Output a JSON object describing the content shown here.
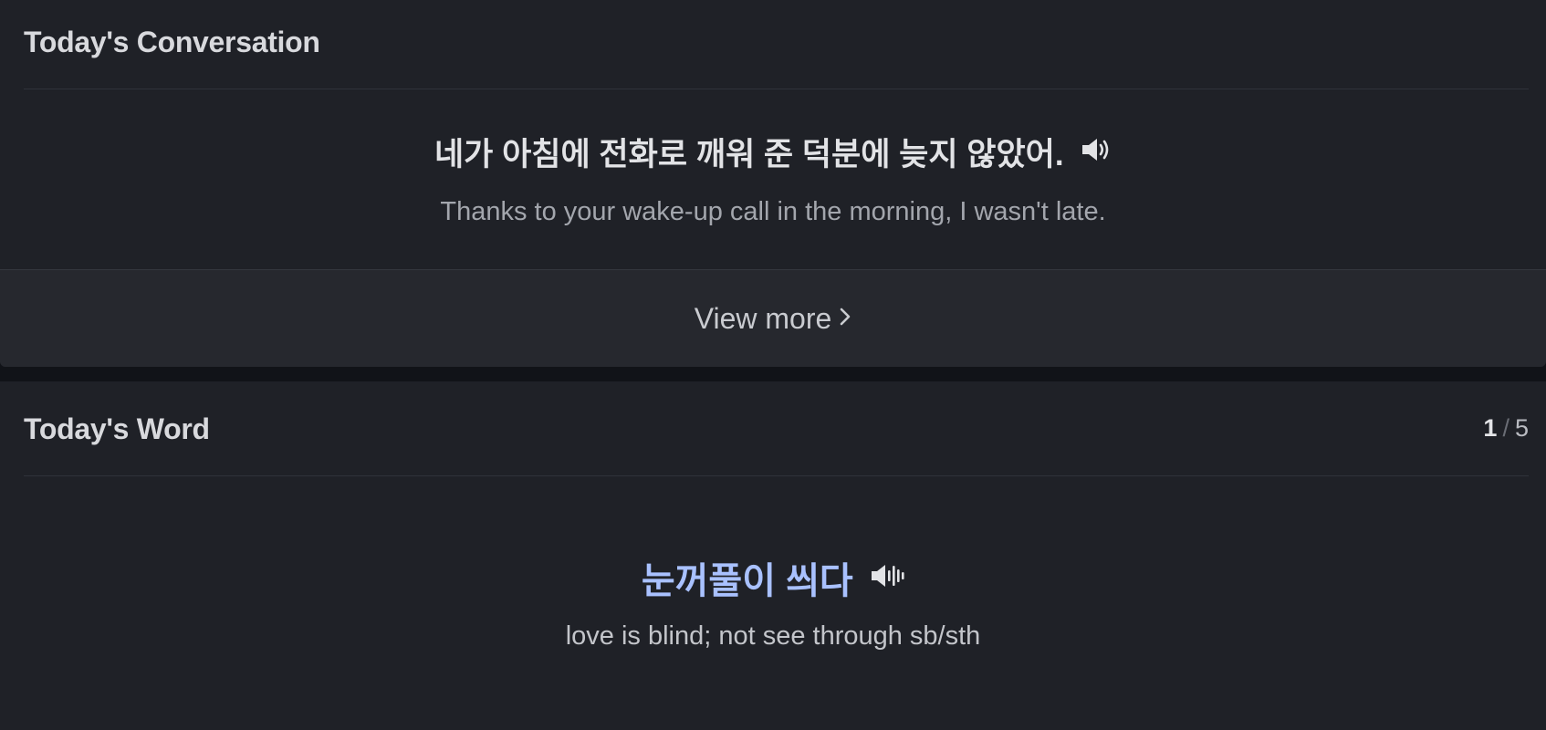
{
  "conversation": {
    "title": "Today's Conversation",
    "sentence_ko": "네가 아침에 전화로 깨워 준 덕분에 늦지 않았어.",
    "sentence_en": "Thanks to your wake-up call in the morning, I wasn't late.",
    "speaker_icon": "speaker-icon",
    "view_more_label": "View more",
    "view_more_icon": "chevron-right-icon"
  },
  "word": {
    "title": "Today's Word",
    "page_current": "1",
    "page_separator": "/",
    "page_total": "5",
    "word_ko": "눈꺼풀이 씌다",
    "word_en": "love is blind; not see through sb/sth",
    "speaker_icon": "speaker-playing-icon"
  },
  "colors": {
    "background": "#1f2127",
    "accent_word": "#a9c1ff",
    "view_more_bg": "#26282e"
  }
}
